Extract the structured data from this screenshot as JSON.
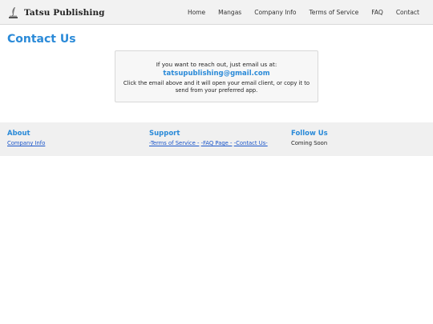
{
  "header": {
    "brand": "Tatsu Publishing",
    "logo_icon": "book-quill-icon",
    "nav": [
      "Home",
      "Mangas",
      "Company Info",
      "Terms of Service",
      "FAQ",
      "Contact"
    ]
  },
  "main": {
    "title": "Contact Us",
    "card": {
      "intro": "If you want to reach out, just email us at:",
      "email": "tatsupublishing@gmail.com",
      "hint": "Click the email above and it will open your email client, or copy it to send from your preferred app."
    }
  },
  "footer": {
    "about": {
      "heading": "About",
      "link": "Company Info"
    },
    "support": {
      "heading": "Support",
      "links": [
        "-Terms of Service -",
        "-FAQ Page -",
        "-Contact Us-"
      ]
    },
    "follow": {
      "heading": "Follow Us",
      "text": "Coming Soon"
    }
  },
  "colors": {
    "accent": "#2a8ad8",
    "link": "#1a55c9",
    "header_bg": "#f2f2f2",
    "footer_bg": "#f0f0f0"
  }
}
